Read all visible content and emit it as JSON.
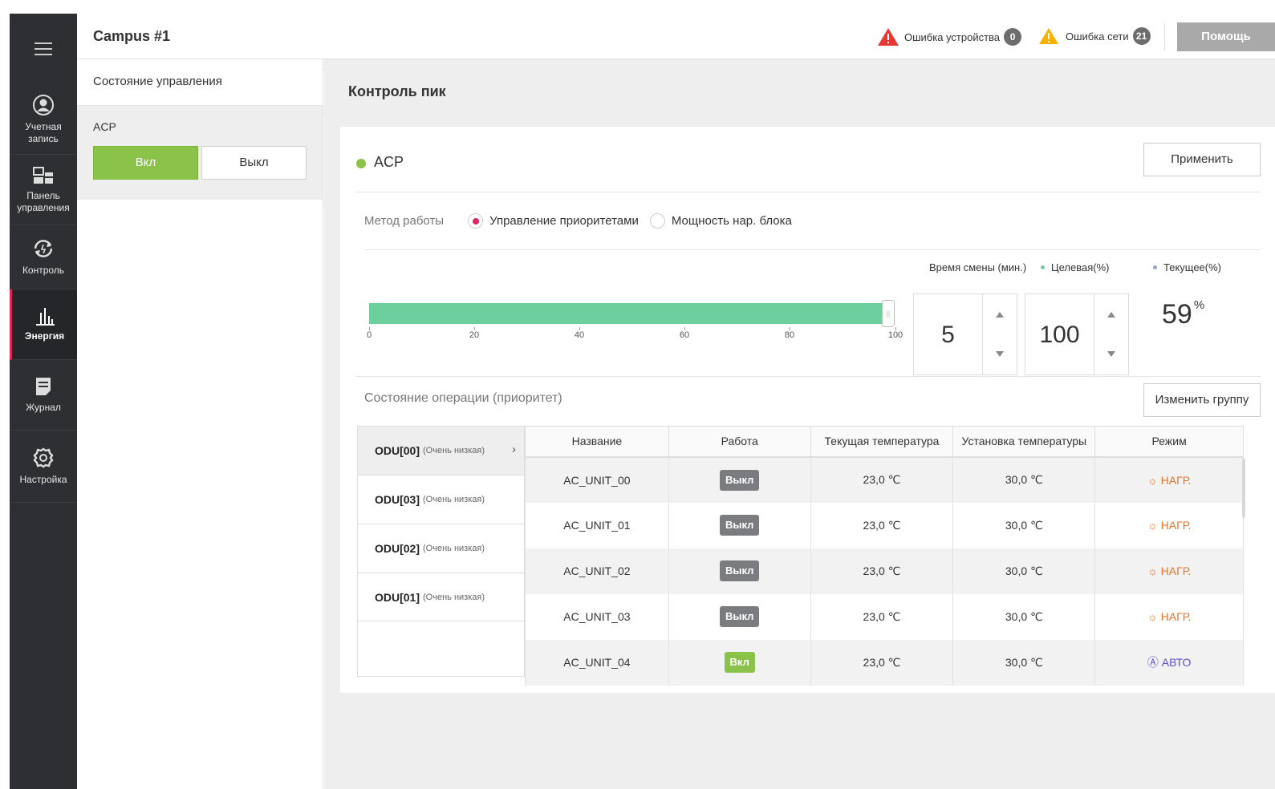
{
  "nav": {
    "items": [
      {
        "label": "Учетная запись",
        "icon": "user-icon"
      },
      {
        "label": "Панель управления",
        "icon": "dashboard-icon"
      },
      {
        "label": "Контроль",
        "icon": "control-icon"
      },
      {
        "label": "Энергия",
        "icon": "energy-icon"
      },
      {
        "label": "Журнал",
        "icon": "journal-icon"
      },
      {
        "label": "Настройка",
        "icon": "gear-icon"
      }
    ]
  },
  "header": {
    "campus": "Campus #1",
    "device_error_label": "Ошибка устройства",
    "device_error_count": "0",
    "network_error_label": "Ошибка сети",
    "network_error_count": "21",
    "help_label": "Помощь"
  },
  "side": {
    "title": "Состояние управления",
    "acp_label": "ACP",
    "on_label": "Вкл",
    "off_label": "Выкл"
  },
  "main": {
    "title": "Контроль пик",
    "acp_label": "ACP",
    "apply_label": "Применить",
    "method_label": "Метод работы",
    "method_option1": "Управление приоритетами",
    "method_option2": "Мощность нар. блока",
    "legend_shift": "Время смены (мин.)",
    "legend_target": "Целевая(%)",
    "legend_current": "Текущее(%)",
    "slider_value": 100,
    "slider_ticks": [
      "0",
      "20",
      "40",
      "60",
      "80",
      "100"
    ],
    "shift_time": "5",
    "target_value": "100",
    "current_value": "59",
    "current_unit": "%",
    "op_status_title": "Состояние операции (приоритет)",
    "change_group_label": "Изменить группу"
  },
  "odu_list": [
    {
      "name": "ODU[00]",
      "priority": "(Очень низкая)"
    },
    {
      "name": "ODU[03]",
      "priority": "(Очень низкая)"
    },
    {
      "name": "ODU[02]",
      "priority": "(Очень низкая)"
    },
    {
      "name": "ODU[01]",
      "priority": "(Очень низкая)"
    }
  ],
  "table": {
    "headers": [
      "Название",
      "Работа",
      "Текущая температура",
      "Установка температуры",
      "Режим"
    ],
    "rows": [
      {
        "name": "AC_UNIT_00",
        "work": "Выкл",
        "cur": "23,0 ℃",
        "set": "30,0 ℃",
        "mode": "НАГР."
      },
      {
        "name": "AC_UNIT_01",
        "work": "Выкл",
        "cur": "23,0 ℃",
        "set": "30,0 ℃",
        "mode": "НАГР."
      },
      {
        "name": "AC_UNIT_02",
        "work": "Выкл",
        "cur": "23,0 ℃",
        "set": "30,0 ℃",
        "mode": "НАГР."
      },
      {
        "name": "AC_UNIT_03",
        "work": "Выкл",
        "cur": "23,0 ℃",
        "set": "30,0 ℃",
        "mode": "НАГР."
      },
      {
        "name": "AC_UNIT_04",
        "work": "Вкл",
        "cur": "23,0 ℃",
        "set": "30,0 ℃",
        "mode": "АВТО"
      }
    ]
  },
  "colors": {
    "accent": "#e0245e",
    "green": "#8bc34a",
    "bar": "#6ccf9d",
    "heat": "#e8742c",
    "auto": "#5b4fd6"
  }
}
